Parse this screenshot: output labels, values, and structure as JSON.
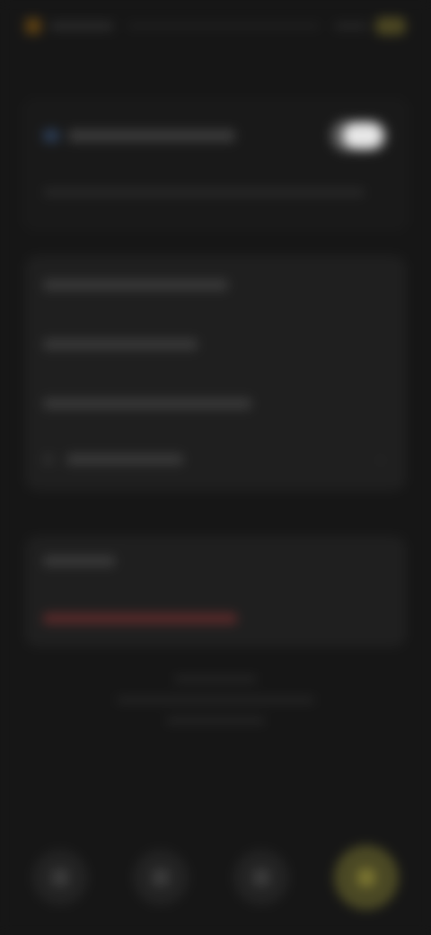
{
  "topbar": {
    "brand_name": "",
    "badge": ""
  },
  "toggle_setting": {
    "label": "",
    "description": "",
    "enabled": true
  },
  "options": [
    {
      "label": ""
    },
    {
      "label": ""
    },
    {
      "label": ""
    },
    {
      "label": ""
    }
  ],
  "danger": {
    "title": "",
    "action_label": ""
  },
  "footer": {
    "line1": "",
    "line2": "",
    "line3": ""
  },
  "nav": {
    "items": [
      {
        "icon": "home-icon"
      },
      {
        "icon": "search-icon"
      },
      {
        "icon": "profile-icon"
      },
      {
        "icon": "settings-icon",
        "active": true
      }
    ]
  },
  "colors": {
    "background": "#161616",
    "accent": "#4a4824",
    "danger": "#5a2a2a",
    "toggle_on": "#e8e8e8"
  }
}
